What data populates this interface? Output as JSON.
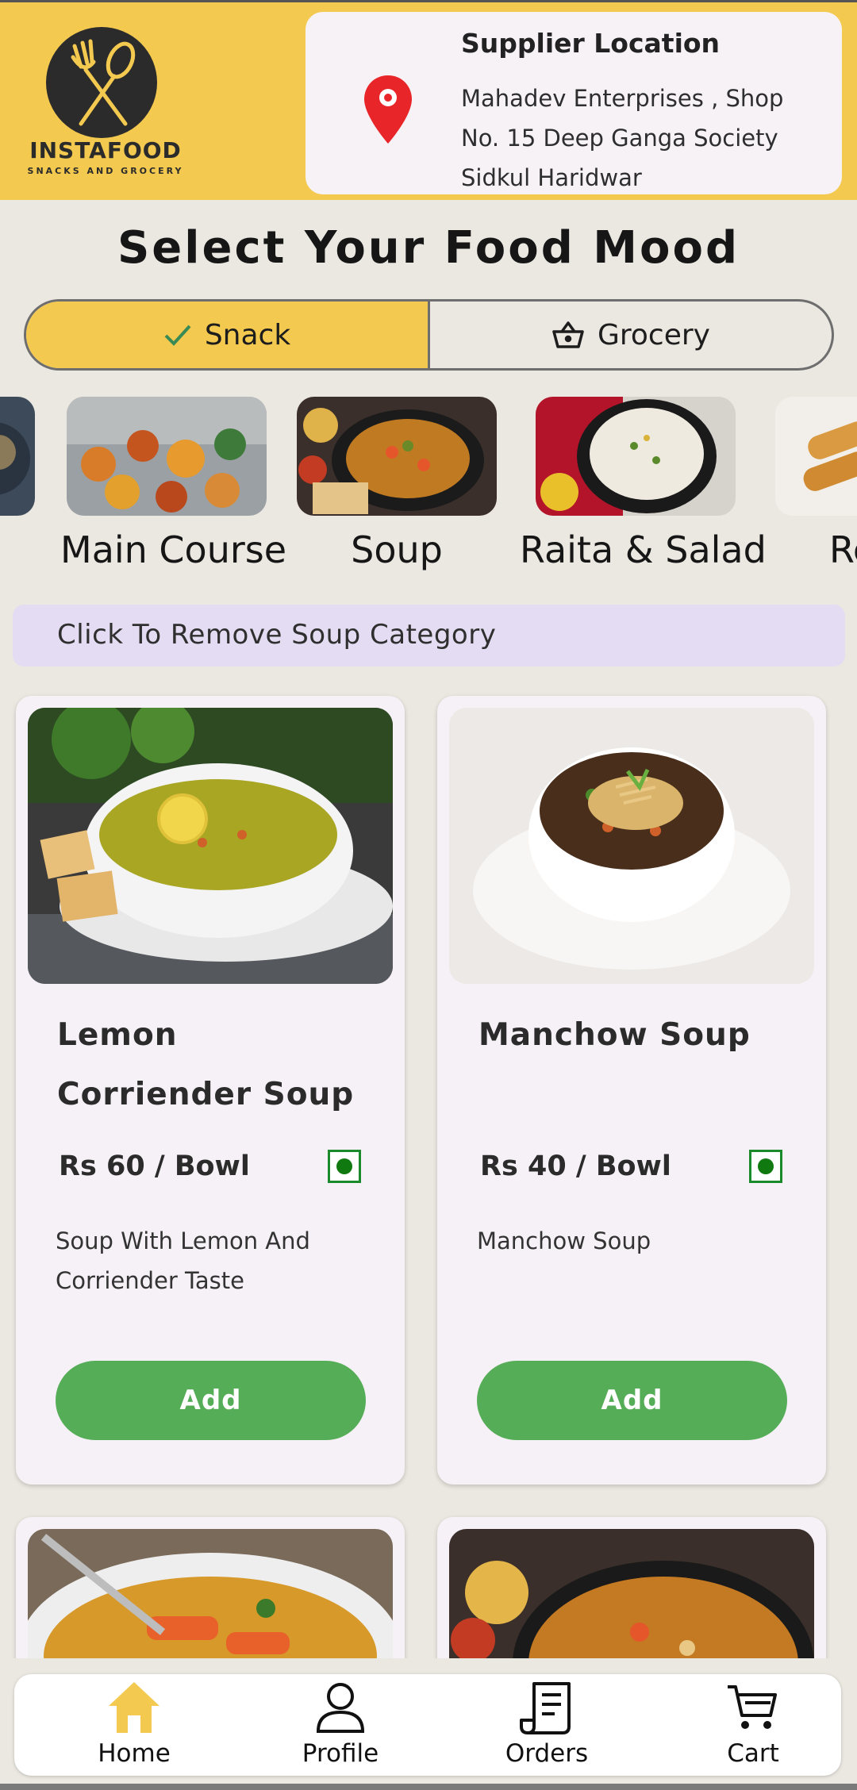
{
  "brand": {
    "name": "INSTAFOOD",
    "tagline": "SNACKS AND GROCERY",
    "accent": "#f3c94f"
  },
  "supplier": {
    "title": "Supplier Location",
    "address": "Mahadev Enterprises , Shop No. 15 Deep Ganga Society Sidkul Haridwar"
  },
  "page_title": "Select Your Food Mood",
  "mode_toggle": {
    "snack": "Snack",
    "grocery": "Grocery",
    "selected": "Snack"
  },
  "categories": [
    {
      "label": "Main Course"
    },
    {
      "label": "Soup"
    },
    {
      "label": "Raita & Salad"
    },
    {
      "label": "Re"
    }
  ],
  "remove_filter": "Click To Remove Soup Category",
  "products": [
    {
      "name": "Lemon Corriender Soup",
      "price": "Rs 60 / Bowl",
      "description": "Soup With Lemon And Corriender Taste",
      "button": "Add"
    },
    {
      "name": "Manchow Soup",
      "price": "Rs 40 / Bowl",
      "description": "Manchow Soup",
      "button": "Add"
    }
  ],
  "nav": {
    "home": "Home",
    "profile": "Profile",
    "orders": "Orders",
    "cart": "Cart",
    "active": "Home"
  },
  "colors": {
    "add_button": "#56ad58",
    "veg_mark": "#107a10",
    "banner": "#e4dcf2",
    "home_icon": "#f3c94f"
  }
}
